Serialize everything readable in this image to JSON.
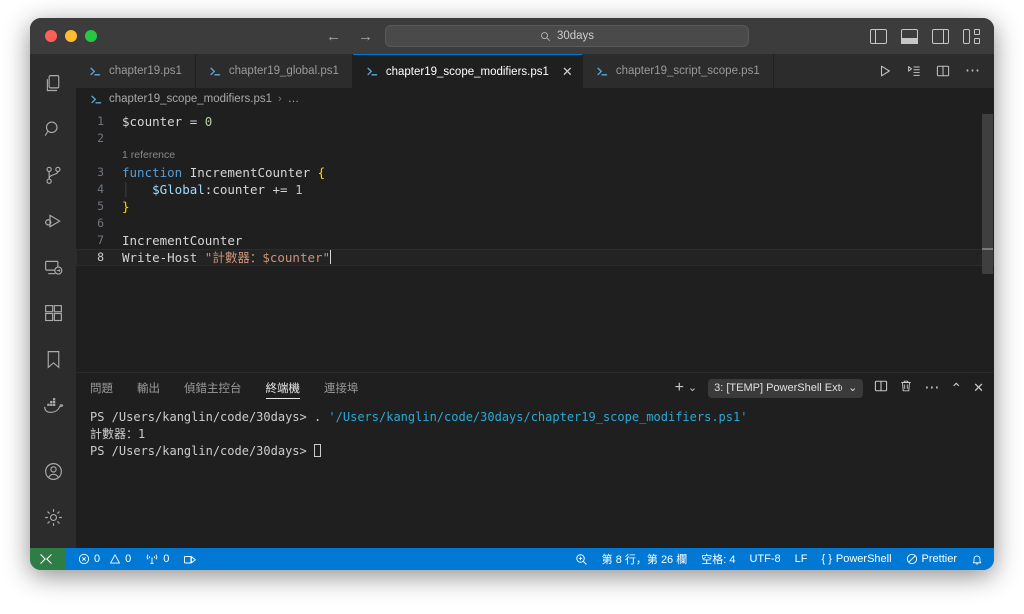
{
  "window": {
    "traffic_lights": [
      "close",
      "minimize",
      "maximize"
    ],
    "quick_open_text": "30days",
    "nav_back": "←",
    "nav_forward": "→"
  },
  "layout_icons": [
    {
      "name": "toggle-primary-sidebar-icon",
      "label": "Toggle Primary Side Bar"
    },
    {
      "name": "toggle-panel-icon",
      "label": "Toggle Panel"
    },
    {
      "name": "toggle-secondary-sidebar-icon",
      "label": "Toggle Secondary Side Bar"
    },
    {
      "name": "customize-layout-icon",
      "label": "Customize Layout"
    }
  ],
  "activitybar": {
    "items": [
      {
        "name": "explorer",
        "icon": "files-icon"
      },
      {
        "name": "search",
        "icon": "search-icon"
      },
      {
        "name": "source-control",
        "icon": "source-control-icon"
      },
      {
        "name": "run-and-debug",
        "icon": "run-debug-icon"
      },
      {
        "name": "remote-explorer",
        "icon": "remote-explorer-icon"
      },
      {
        "name": "extensions",
        "icon": "extensions-icon"
      },
      {
        "name": "bookmarks",
        "icon": "bookmark-icon"
      },
      {
        "name": "docker",
        "icon": "docker-whale-icon"
      }
    ],
    "bottom": [
      {
        "name": "accounts",
        "icon": "account-icon"
      },
      {
        "name": "manage-settings",
        "icon": "gear-icon"
      }
    ]
  },
  "tabs": [
    {
      "label": "chapter19.ps1",
      "active": false,
      "closable": false
    },
    {
      "label": "chapter19_global.ps1",
      "active": false,
      "closable": false
    },
    {
      "label": "chapter19_scope_modifiers.ps1",
      "active": true,
      "closable": true,
      "close_glyph": "✕"
    },
    {
      "label": "chapter19_script_scope.ps1",
      "active": false,
      "closable": false
    }
  ],
  "tab_actions": [
    {
      "name": "run-button",
      "icon": "play-icon"
    },
    {
      "name": "run-with-debug-button",
      "icon": "run-with-debug-icon"
    },
    {
      "name": "split-editor-button",
      "icon": "split-editor-icon"
    },
    {
      "name": "more-actions-button",
      "icon": "ellipsis-icon",
      "glyph": "⋯"
    }
  ],
  "breadcrumb": {
    "file": "chapter19_scope_modifiers.ps1",
    "separator": "›",
    "overflow": "…"
  },
  "code": {
    "codelens": "1 reference",
    "lines": [
      {
        "num": "1",
        "current": false,
        "tokens": [
          {
            "t": "$counter ",
            "c": "plain"
          },
          {
            "t": "= ",
            "c": "op"
          },
          {
            "t": "0",
            "c": "num"
          }
        ]
      },
      {
        "num": "2",
        "current": false,
        "tokens": []
      },
      {
        "num": "3",
        "current": false,
        "tokens": [
          {
            "t": "function ",
            "c": "kw"
          },
          {
            "t": "IncrementCounter ",
            "c": "plain"
          },
          {
            "t": "{",
            "c": "brace"
          }
        ]
      },
      {
        "num": "4",
        "current": false,
        "indent": true,
        "tokens": [
          {
            "t": "    ",
            "c": "plain"
          },
          {
            "t": "$Global",
            "c": "var"
          },
          {
            "t": ":counter ",
            "c": "plain"
          },
          {
            "t": "+= ",
            "c": "op"
          },
          {
            "t": "1",
            "c": "num"
          }
        ]
      },
      {
        "num": "5",
        "current": false,
        "tokens": [
          {
            "t": "}",
            "c": "brace"
          }
        ]
      },
      {
        "num": "6",
        "current": false,
        "tokens": []
      },
      {
        "num": "7",
        "current": false,
        "tokens": [
          {
            "t": "IncrementCounter",
            "c": "plain"
          }
        ]
      },
      {
        "num": "8",
        "current": true,
        "caret": true,
        "tokens": [
          {
            "t": "Write-Host ",
            "c": "plain"
          },
          {
            "t": "\"計數器：$counter\"",
            "c": "str"
          }
        ]
      }
    ]
  },
  "panel": {
    "tabs": [
      {
        "label": "問題",
        "active": false
      },
      {
        "label": "輸出",
        "active": false
      },
      {
        "label": "偵錯主控台",
        "active": false
      },
      {
        "label": "終端機",
        "active": true
      },
      {
        "label": "連接埠",
        "active": false
      }
    ],
    "new_terminal_glyph": "+",
    "dropdown_caret": "⌄",
    "terminal_selector": "3: [TEMP] PowerShell Exte",
    "actions": [
      {
        "name": "split-terminal-button",
        "icon": "split-terminal-icon"
      },
      {
        "name": "kill-terminal-button",
        "icon": "trash-icon"
      },
      {
        "name": "panel-more-actions-button",
        "icon": "ellipsis-icon",
        "glyph": "⋯"
      },
      {
        "name": "maximize-panel-button",
        "icon": "chevron-up-icon",
        "glyph": "⌃"
      },
      {
        "name": "close-panel-button",
        "icon": "close-icon",
        "glyph": "✕"
      }
    ],
    "terminal_lines": [
      {
        "parts": [
          {
            "t": "PS /Users/kanglin/code/30days> . ",
            "c": "plain"
          },
          {
            "t": "'/Users/kanglin/code/30days/chapter19_scope_modifiers.ps1'",
            "c": "path"
          }
        ]
      },
      {
        "parts": [
          {
            "t": "計數器：1",
            "c": "plain"
          }
        ]
      },
      {
        "parts": [
          {
            "t": "PS /Users/kanglin/code/30days> ",
            "c": "plain"
          }
        ],
        "cursor": true
      }
    ]
  },
  "statusbar": {
    "remote_label": "",
    "errors": "0",
    "warnings": "0",
    "ports": "0",
    "cursor_position": "第 8 行，第 26 欄",
    "indentation": "空格: 4",
    "encoding": "UTF-8",
    "eol": "LF",
    "language": "PowerShell",
    "formatter": "Prettier",
    "formatter_glyph": "⊘",
    "language_glyph": "{ }",
    "bell_glyph": "🔔"
  },
  "colors": {
    "accent": "#0078d4",
    "remote_green": "#2e7d46",
    "editor_bg": "#1f1f1f",
    "chrome_bg": "#2c2c2c",
    "titlebar_bg": "#3c3c3c",
    "keyword_blue": "#569cd6",
    "variable_blue": "#9cdcfe",
    "string_orange": "#ce9178",
    "number_green": "#b5cea8",
    "brace_yellow": "#ffd700",
    "terminal_path": "#2aa9d4"
  }
}
